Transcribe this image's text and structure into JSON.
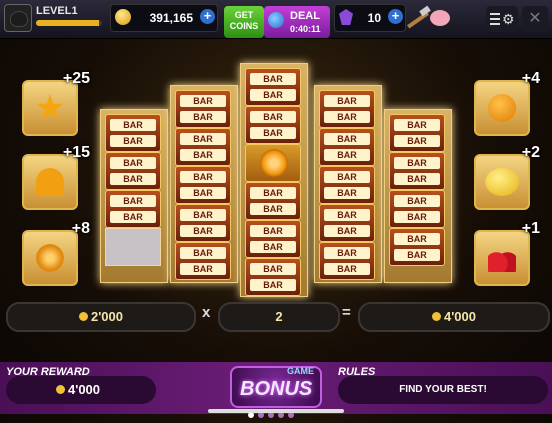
{
  "header": {
    "level_label": "LEVEL1",
    "level_progress": 0.95,
    "coins": "391,165",
    "get_coins_label": "GET\nCOINS",
    "deal_label": "DEAL",
    "deal_timer": "0:40:11",
    "gems": "10",
    "plus_symbol": "+",
    "close_symbol": "✕"
  },
  "left_multipliers": [
    {
      "mult": "+25",
      "icon": "star-icon"
    },
    {
      "mult": "+15",
      "icon": "bell-icon"
    },
    {
      "mult": "+8",
      "icon": "orange-half-icon"
    }
  ],
  "right_multipliers": [
    {
      "mult": "+4",
      "icon": "orange-icon"
    },
    {
      "mult": "+2",
      "icon": "lemon-icon"
    },
    {
      "mult": "+1",
      "icon": "cherry-icon"
    }
  ],
  "reel_symbol_text": "BAR",
  "calc": {
    "base": "2'000",
    "times": "x",
    "multiplier": "2",
    "equals": "=",
    "result": "4'000"
  },
  "footer": {
    "your_reward_label": "YOUR REWARD",
    "your_reward_value": "4'000",
    "bonus_game_small": "GAME",
    "bonus_word": "BONUS",
    "rules_label": "RULES",
    "rules_text": "FIND YOUR BEST!",
    "page_dots": 5,
    "active_dot": 0
  }
}
